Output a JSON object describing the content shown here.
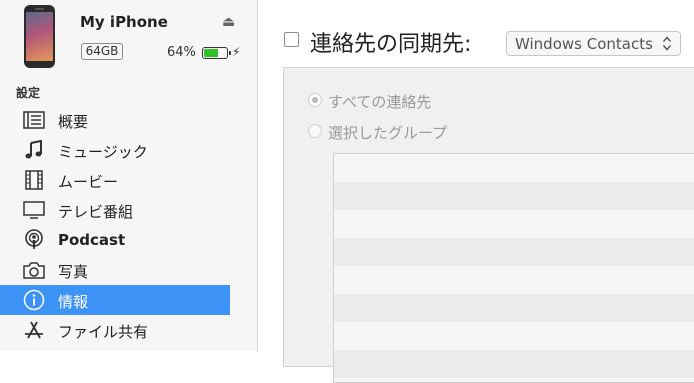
{
  "device": {
    "name": "My iPhone",
    "capacity": "64GB",
    "battery_percent_label": "64%",
    "battery_level": 0.64,
    "battery_color": "#2ec227",
    "eject_icon": "eject-icon",
    "charging_icon": "charging-bolt-icon"
  },
  "sidebar": {
    "section_label": "設定",
    "selected_color": "#3c93f5",
    "items": [
      {
        "label": "概要",
        "icon": "summary-list-icon",
        "selected": false
      },
      {
        "label": "ミュージック",
        "icon": "music-note-icon",
        "selected": false
      },
      {
        "label": "ムービー",
        "icon": "film-icon",
        "selected": false
      },
      {
        "label": "テレビ番組",
        "icon": "tv-icon",
        "selected": false
      },
      {
        "label": "Podcast",
        "icon": "podcast-icon",
        "selected": false
      },
      {
        "label": "写真",
        "icon": "camera-icon",
        "selected": false
      },
      {
        "label": "情報",
        "icon": "info-icon",
        "selected": true
      },
      {
        "label": "ファイル共有",
        "icon": "app-store-icon",
        "selected": false
      }
    ]
  },
  "main": {
    "sync_checked": false,
    "sync_title": "連絡先の同期先:",
    "sync_source": "Windows Contacts",
    "options": {
      "all_contacts": "すべての連絡先",
      "selected_groups": "選択したグループ",
      "selected_option": "all_contacts"
    },
    "groups": []
  }
}
